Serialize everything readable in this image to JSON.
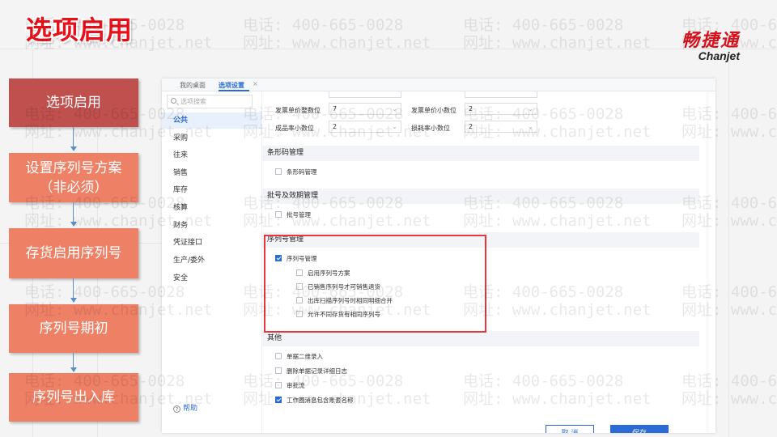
{
  "slide": {
    "title": "选项启用",
    "brand_cn": "畅捷通",
    "brand_en": "Chanjet",
    "watermark_phone": "电话: 400-665-0028",
    "watermark_site": "网址: www.chanjet.net"
  },
  "steps": [
    {
      "label": "选项启用",
      "active": true
    },
    {
      "label": "设置序列号方案（非必须）",
      "active": false
    },
    {
      "label": "存货启用序列号",
      "active": false
    },
    {
      "label": "序列号期初",
      "active": false
    },
    {
      "label": "序列号出入库",
      "active": false
    }
  ],
  "tabs": {
    "home": "我的桌面",
    "active": "选项设置",
    "close": "×"
  },
  "sidebar": {
    "search_placeholder": "选项搜索",
    "items": [
      "公共",
      "采购",
      "往来",
      "销售",
      "库存",
      "核算",
      "财务",
      "凭证接口",
      "生产/委外",
      "安全"
    ],
    "active_index": 0,
    "help": "帮助"
  },
  "fields": [
    {
      "label": "发票单价整数位",
      "value": "7"
    },
    {
      "label": "发票单价小数位",
      "value": "2"
    },
    {
      "label": "成品率小数位",
      "value": "2"
    },
    {
      "label": "损耗率小数位",
      "value": "2"
    }
  ],
  "sections": {
    "barcode": {
      "title": "条形码管理",
      "items": [
        {
          "label": "条形码管理",
          "checked": false
        }
      ]
    },
    "batch": {
      "title": "批号及效期管理",
      "items": [
        {
          "label": "批号管理",
          "checked": false
        }
      ]
    },
    "serial": {
      "title": "序列号管理",
      "main": {
        "label": "序列号管理",
        "checked": true
      },
      "subs": [
        {
          "label": "启用序列号方案",
          "checked": false
        },
        {
          "label": "已销售序列号才可销售退货",
          "checked": false
        },
        {
          "label": "出库扫描序列号时相同明细合并",
          "checked": false
        },
        {
          "label": "允许不同存货有相同序列号",
          "checked": false
        }
      ]
    },
    "other": {
      "title": "其他",
      "items": [
        {
          "label": "单据二维录入",
          "checked": false
        },
        {
          "label": "删除单据记录详细日志",
          "checked": false
        },
        {
          "label": "审批流",
          "checked": false
        },
        {
          "label": "工作圈消息包含账套名称",
          "checked": true
        }
      ]
    }
  },
  "buttons": {
    "cancel": "取 消",
    "save": "保存"
  },
  "colors": {
    "accent": "#2a6bd6",
    "step_active": "#c0504d",
    "step": "#ee8066",
    "title": "#e8101a",
    "highlight": "#e8363c"
  }
}
